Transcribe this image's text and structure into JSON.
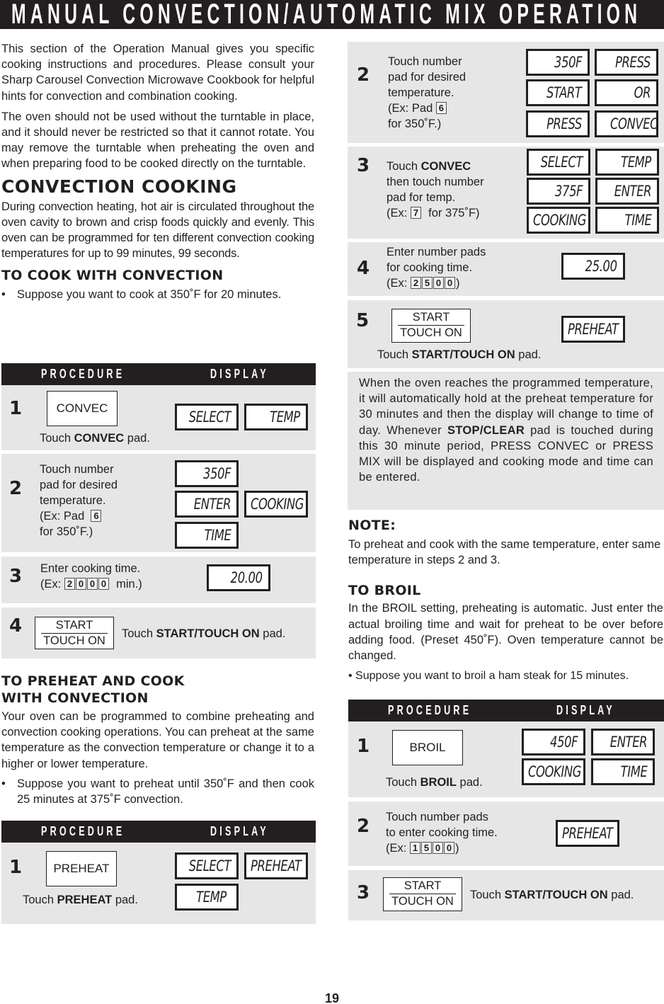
{
  "title": "MANUAL CONVECTION/AUTOMATIC MIX OPERATION",
  "intro": {
    "p1": "This section of the Operation Manual gives you specific cooking instructions and procedures. Please consult your Sharp Carousel Convection Microwave Cookbook for helpful hints for convection and combination cooking.",
    "p2": "The oven should not be used without the turntable in place, and it should never be restricted so that it cannot rotate. You may remove the turntable when preheating the oven and when preparing food to be cooked directly on the turntable."
  },
  "convection_cooking": {
    "heading": "CONVECTION COOKING",
    "body": "During convection heating, hot air is circulated throughout the oven cavity to brown and crisp foods quickly and evenly. This oven can be programmed for ten different convection cooking temperatures for up to 99 minutes, 99 seconds."
  },
  "procedure_header": {
    "procedure": "PROCEDURE",
    "display": "DISPLAY"
  },
  "cook_with_convection": {
    "heading": "TO COOK WITH CONVECTION",
    "bullet": "Suppose you want to cook at 350˚F for 20 minutes.",
    "steps": [
      {
        "num": "1",
        "pad": "CONVEC",
        "text_pre": "Touch ",
        "text_bold": "CONVEC",
        "text_post": " pad.",
        "displays": [
          "SELECT",
          "TEMP"
        ]
      },
      {
        "num": "2",
        "lines": [
          "Touch number",
          "pad for desired",
          "temperature.",
          "(Ex: Pad",
          "for 350˚F.)"
        ],
        "key": "6",
        "displays": [
          "350F",
          "ENTER",
          "COOKING",
          "TIME"
        ]
      },
      {
        "num": "3",
        "lines": [
          "Enter cooking time.",
          "(Ex:",
          "min.)"
        ],
        "keys": [
          "2",
          "0",
          "0",
          "0"
        ],
        "displays": [
          "20.00"
        ]
      },
      {
        "num": "4",
        "pad_top": "START",
        "pad_bottom": "TOUCH ON",
        "text_pre": "Touch ",
        "text_bold": "START/TOUCH ON",
        "text_post": " pad."
      }
    ]
  },
  "preheat_and_cook": {
    "heading_line1": "TO PREHEAT AND COOK",
    "heading_line2": "WITH CONVECTION",
    "body": "Your oven can be programmed to combine preheating and convection cooking operations. You can preheat at the same temperature as the convection temperature or change it to a higher or lower temperature.",
    "bullet": "Suppose you want to preheat until 350˚F and then cook 25 minutes at 375˚F convection.",
    "steps": [
      {
        "num": "1",
        "pad": "PREHEAT",
        "text_pre": "Touch ",
        "text_bold": "PREHEAT",
        "text_post": " pad.",
        "displays": [
          "SELECT",
          "PREHEAT",
          "TEMP"
        ]
      },
      {
        "num": "2",
        "lines": [
          "Touch number",
          "pad for desired",
          "temperature.",
          "(Ex: Pad",
          "for 350˚F.)"
        ],
        "key": "6",
        "displays": [
          "350F",
          "PRESS",
          "START",
          "OR",
          "PRESS",
          "CONVEC"
        ]
      },
      {
        "num": "3",
        "text_pre": "Touch ",
        "text_bold": "CONVEC",
        "lines": [
          "then touch number",
          "pad for temp.",
          "(Ex:",
          "for 375˚F)"
        ],
        "key": "7",
        "displays": [
          "SELECT",
          "TEMP",
          "375F",
          "ENTER",
          "COOKING",
          "TIME"
        ]
      },
      {
        "num": "4",
        "lines": [
          "Enter number pads",
          "for cooking time.",
          "(Ex:",
          ")"
        ],
        "keys": [
          "2",
          "5",
          "0",
          "0"
        ],
        "displays": [
          "25.00"
        ]
      },
      {
        "num": "5",
        "pad_top": "START",
        "pad_bottom": "TOUCH ON",
        "text_pre": "Touch ",
        "text_bold": "START/TOUCH ON",
        "text_post": " pad.",
        "displays": [
          "PREHEAT"
        ]
      }
    ],
    "hold_note_pre": "When the oven reaches the programmed temperature, it will automatically hold at the preheat temperature for 30 minutes and then the display will change to time of day. Whenever ",
    "hold_note_bold": "STOP/CLEAR",
    "hold_note_post": " pad is touched during this 30 minute period, PRESS CONVEC or PRESS MIX will be displayed and cooking mode and time can be entered."
  },
  "note": {
    "heading": "NOTE:",
    "body": "To preheat and cook with the same temperature, enter same temperature in steps 2 and 3."
  },
  "broil": {
    "heading": "TO BROIL",
    "body": "In the BROIL setting, preheating is automatic. Just enter the actual broiling time and wait for preheat to be over before adding food. (Preset 450˚F). Oven temperature cannot be changed.",
    "bullet": "• Suppose you want to broil a ham steak for 15 minutes.",
    "steps": [
      {
        "num": "1",
        "pad": "BROIL",
        "text_pre": "Touch ",
        "text_bold": "BROIL",
        "text_post": " pad.",
        "displays": [
          "450F",
          "ENTER",
          "COOKING",
          "TIME"
        ]
      },
      {
        "num": "2",
        "lines": [
          "Touch number pads",
          "to enter cooking time.",
          "(Ex:",
          ")"
        ],
        "keys": [
          "1",
          "5",
          "0",
          "0"
        ],
        "displays": [
          "PREHEAT"
        ]
      },
      {
        "num": "3",
        "pad_top": "START",
        "pad_bottom": "TOUCH ON",
        "text_pre": "Touch ",
        "text_bold": "START/TOUCH ON",
        "text_post": " pad."
      }
    ]
  },
  "page_number": "19"
}
